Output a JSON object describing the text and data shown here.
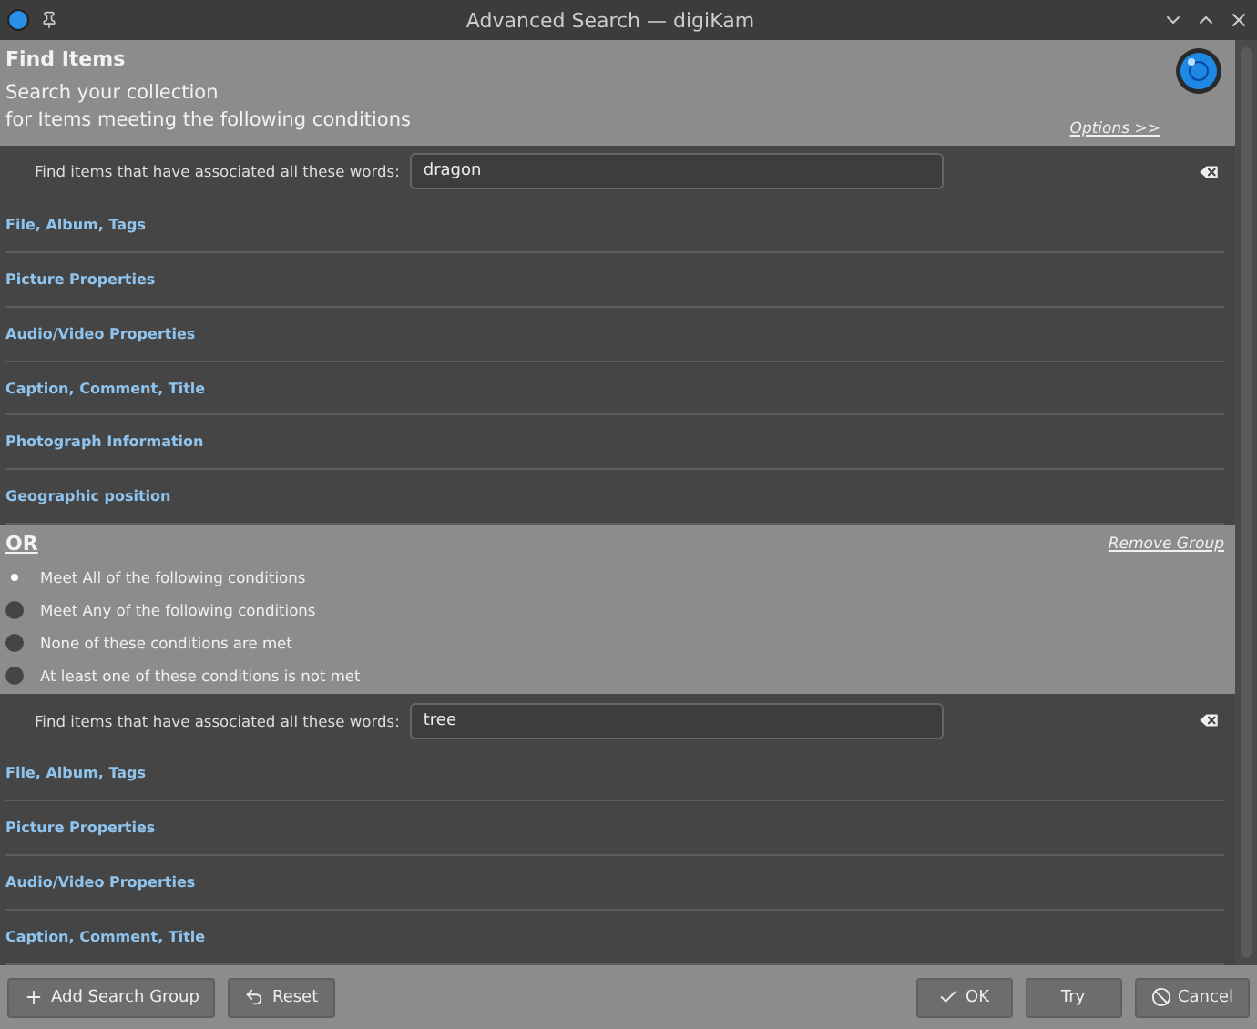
{
  "window": {
    "title": "Advanced Search — digiKam"
  },
  "header": {
    "title": "Find Items",
    "subtitle_lines": [
      "Search your collection",
      "for Items meeting the following conditions"
    ],
    "options_link": "Options >>"
  },
  "groups": [
    {
      "keyword_label": "Find items that have associated all these words:",
      "keyword_value": "dragon",
      "sections": [
        "File, Album, Tags",
        "Picture Properties",
        "Audio/Video Properties",
        "Caption, Comment, Title",
        "Photograph Information",
        "Geographic position"
      ]
    },
    {
      "operator": "OR",
      "remove_link": "Remove Group",
      "conditions": [
        {
          "label": "Meet All of the following conditions",
          "selected": true
        },
        {
          "label": "Meet Any of the following conditions",
          "selected": false
        },
        {
          "label": "None of these conditions are met",
          "selected": false
        },
        {
          "label": "At least one of these conditions is not met",
          "selected": false
        }
      ],
      "keyword_label": "Find items that have associated all these words:",
      "keyword_value": "tree",
      "sections": [
        "File, Album, Tags",
        "Picture Properties",
        "Audio/Video Properties",
        "Caption, Comment, Title"
      ]
    }
  ],
  "buttons": [
    {
      "kind": "add",
      "label": "Add Search Group"
    },
    {
      "kind": "reset",
      "label": "Reset"
    },
    {
      "kind": "ok",
      "label": "OK"
    },
    {
      "kind": "try",
      "label": "Try"
    },
    {
      "kind": "cancel",
      "label": "Cancel"
    }
  ]
}
